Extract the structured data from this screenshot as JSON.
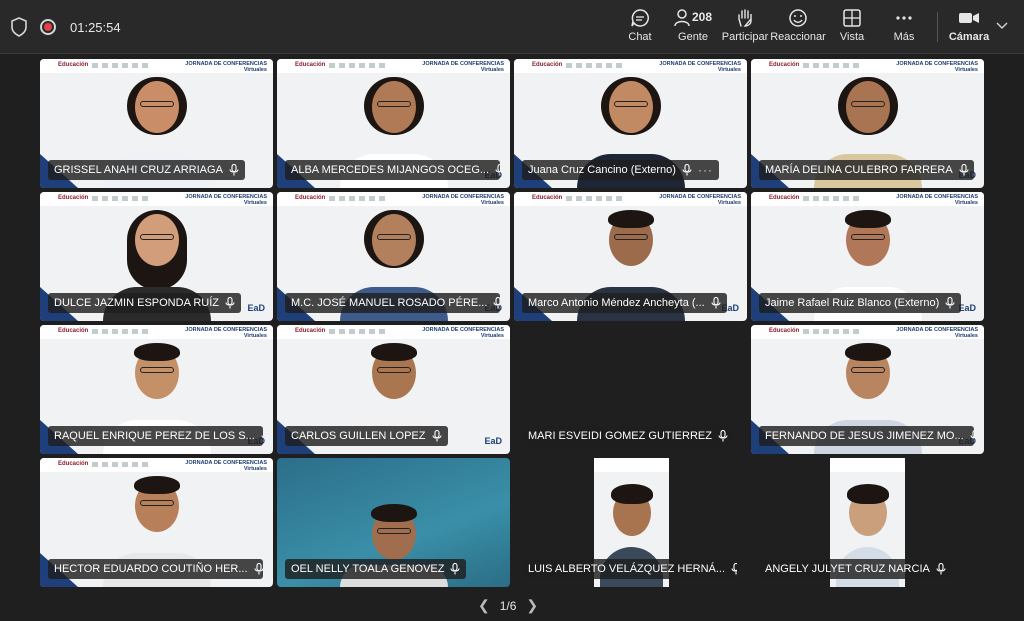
{
  "toolbar": {
    "timer": "01:25:54",
    "chat": "Chat",
    "people_label": "Gente",
    "people_count": "208",
    "participate": "Participar",
    "react": "Reaccionar",
    "view": "Vista",
    "more": "Más",
    "camera": "Cámara"
  },
  "tiles": [
    {
      "name": "GRISSEL ANAHI CRUZ ARRIAGA"
    },
    {
      "name": "ALBA MERCEDES MIJANGOS OCEG..."
    },
    {
      "name": "Juana Cruz Cancino (Externo)"
    },
    {
      "name": "MARÍA DELINA CULEBRO FARRERA"
    },
    {
      "name": "DULCE JAZMIN ESPONDA RUÍZ"
    },
    {
      "name": "M.C. JOSÉ MANUEL ROSADO PÉRE..."
    },
    {
      "name": "Marco Antonio Méndez Ancheyta (..."
    },
    {
      "name": "Jaime Rafael Ruiz Blanco (Externo)"
    },
    {
      "name": "RAQUEL ENRIQUE PEREZ DE LOS S..."
    },
    {
      "name": "CARLOS GUILLEN LOPEZ"
    },
    {
      "name": "MARI ESVEIDI GOMEZ GUTIERREZ"
    },
    {
      "name": "FERNANDO DE JESUS JIMENEZ MO..."
    },
    {
      "name": "HECTOR EDUARDO COUTIÑO HER..."
    },
    {
      "name": "OEL NELLY TOALA GENOVEZ"
    },
    {
      "name": "LUIS ALBERTO VELÁZQUEZ HERNÁ..."
    },
    {
      "name": "ANGELY JULYET CRUZ NARCIA"
    }
  ],
  "banner": {
    "edu": "Educación",
    "title": "JORNADA DE CONFERENCIAS",
    "subtitle": "Virtuales",
    "ead": "EaD"
  },
  "pager": {
    "label": "1/6"
  }
}
